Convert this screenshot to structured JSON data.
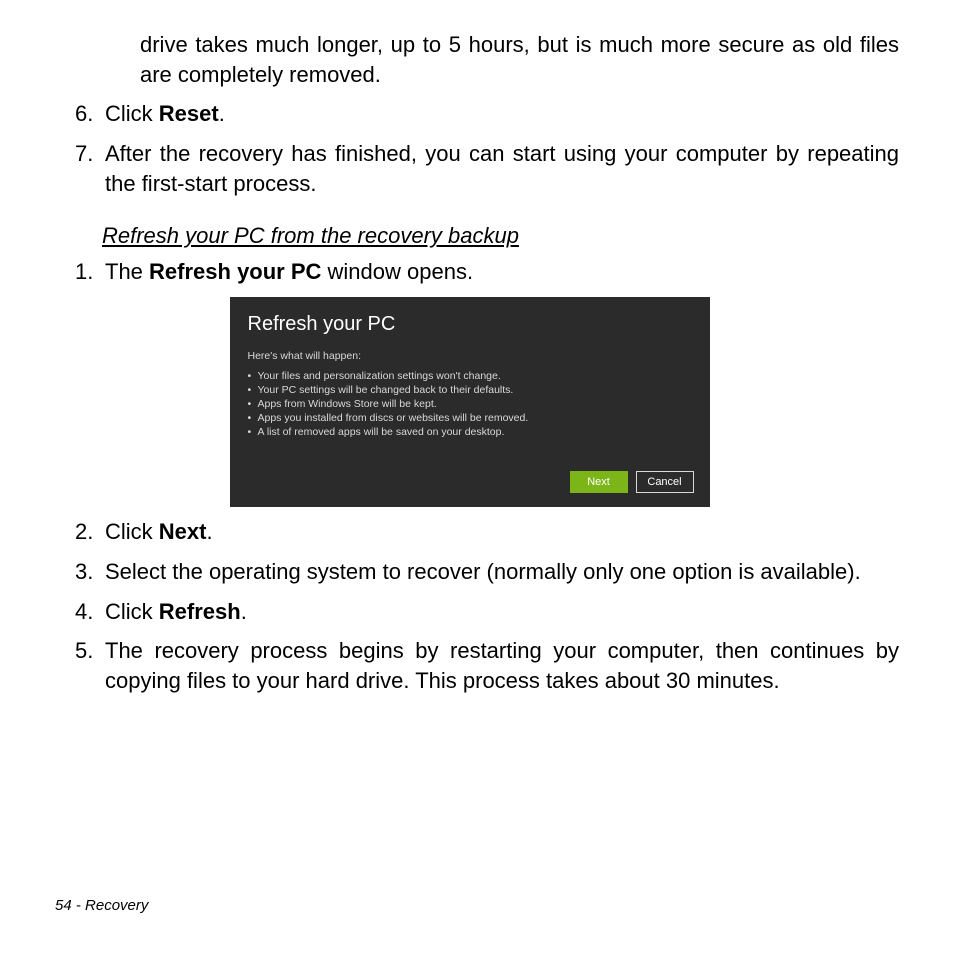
{
  "intro_cont": "drive takes much longer, up to 5 hours, but is much more secure as old files are completely removed.",
  "stepsA": [
    {
      "num": "6.",
      "pre": "Click ",
      "bold": "Reset",
      "post": "."
    },
    {
      "num": "7.",
      "pre": "After the recovery has finished, you can start using your computer by repeating the first-start process.",
      "bold": "",
      "post": ""
    }
  ],
  "section_title": "Refresh your PC from the recovery backup",
  "stepsB": [
    {
      "num": "1.",
      "pre": "The ",
      "bold": "Refresh your PC",
      "post": " window opens."
    },
    {
      "num": "2.",
      "pre": "Click ",
      "bold": "Next",
      "post": "."
    },
    {
      "num": "3.",
      "pre": "Select the operating system to recover (normally only one option is available).",
      "bold": "",
      "post": ""
    },
    {
      "num": "4.",
      "pre": "Click ",
      "bold": "Refresh",
      "post": "."
    },
    {
      "num": "5.",
      "pre": "The recovery process begins by restarting your computer, then continues by copying files to your hard drive. This process takes about 30 minutes.",
      "bold": "",
      "post": ""
    }
  ],
  "dialog": {
    "title": "Refresh your PC",
    "subtitle": "Here's what will happen:",
    "bullets": [
      "Your files and personalization settings won't change.",
      "Your PC settings will be changed back to their defaults.",
      "Apps from Windows Store will be kept.",
      "Apps you installed from discs or websites will be removed.",
      "A list of removed apps will be saved on your desktop."
    ],
    "next_label": "Next",
    "cancel_label": "Cancel"
  },
  "footer": "54 - Recovery"
}
